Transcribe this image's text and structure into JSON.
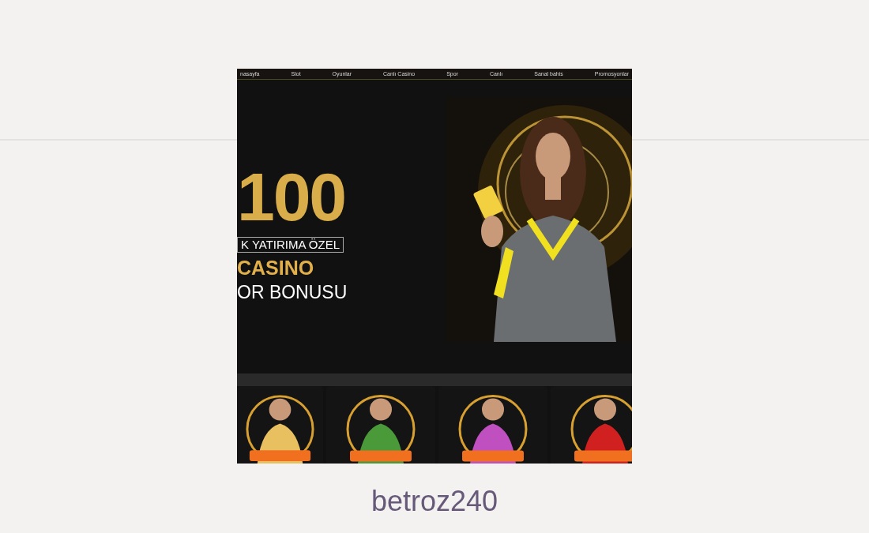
{
  "nav": {
    "items": [
      "nasayfa",
      "Slot",
      "Oyunlar",
      "Canlı Casino",
      "Spor",
      "Canlı",
      "Sanal bahis",
      "Promosyonlar"
    ]
  },
  "banner": {
    "amount": "100",
    "tag": "K YATIRIMA ÖZEL",
    "title": "CASINO",
    "subtitle": "OR BONUSU"
  },
  "caption": "betroz240"
}
